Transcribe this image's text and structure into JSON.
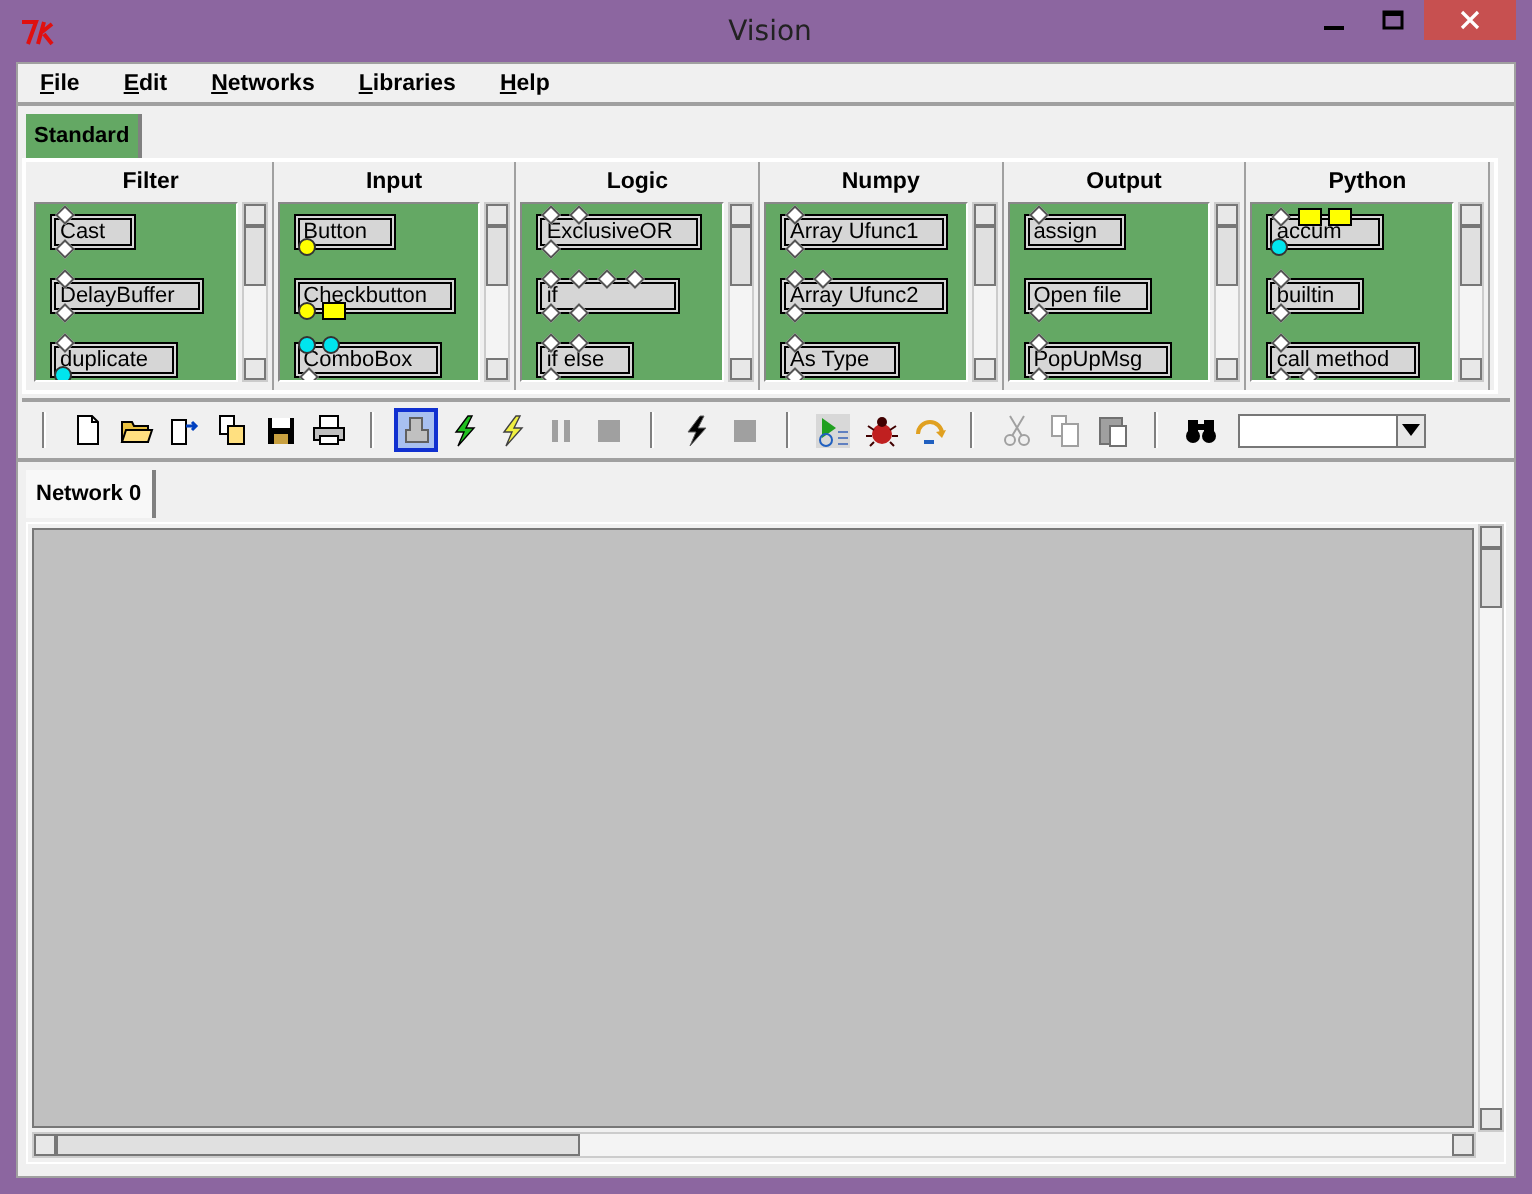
{
  "window": {
    "title": "Vision"
  },
  "menu": [
    {
      "label": "File"
    },
    {
      "label": "Edit"
    },
    {
      "label": "Networks"
    },
    {
      "label": "Libraries"
    },
    {
      "label": "Help"
    }
  ],
  "library_tabs": [
    {
      "label": "Standard",
      "selected": true
    }
  ],
  "categories": [
    {
      "name": "Filter",
      "nodes": [
        {
          "label": "Cast",
          "top": [
            {
              "kind": "diamond"
            }
          ],
          "bottom": [
            {
              "kind": "diamond"
            }
          ]
        },
        {
          "label": "DelayBuffer",
          "top": [
            {
              "kind": "diamond"
            }
          ],
          "bottom": [
            {
              "kind": "diamond"
            }
          ]
        },
        {
          "label": "duplicate",
          "top": [
            {
              "kind": "diamond"
            }
          ],
          "bottom": [
            {
              "kind": "dot",
              "color": "#00e5ee"
            }
          ]
        }
      ]
    },
    {
      "name": "Input",
      "nodes": [
        {
          "label": "Button",
          "bottom": [
            {
              "kind": "dot",
              "color": "#ffff00"
            }
          ]
        },
        {
          "label": "Checkbutton",
          "bottom": [
            {
              "kind": "dot",
              "color": "#ffff00"
            },
            {
              "kind": "square",
              "color": "#ffff00"
            }
          ]
        },
        {
          "label": "ComboBox",
          "top": [
            {
              "kind": "dot",
              "color": "#00e5ee"
            },
            {
              "kind": "dot",
              "color": "#00e5ee"
            }
          ],
          "bottom": [
            {
              "kind": "diamond"
            }
          ]
        }
      ]
    },
    {
      "name": "Logic",
      "nodes": [
        {
          "label": "ExclusiveOR",
          "top": [
            {
              "kind": "diamond"
            },
            {
              "kind": "diamond"
            }
          ],
          "bottom": [
            {
              "kind": "diamond"
            }
          ]
        },
        {
          "label": "if",
          "top": [
            {
              "kind": "diamond"
            },
            {
              "kind": "diamond"
            },
            {
              "kind": "diamond"
            },
            {
              "kind": "diamond"
            }
          ],
          "bottom": [
            {
              "kind": "diamond"
            },
            {
              "kind": "diamond"
            }
          ]
        },
        {
          "label": "if else",
          "top": [
            {
              "kind": "diamond"
            },
            {
              "kind": "diamond"
            }
          ],
          "bottom": [
            {
              "kind": "diamond"
            }
          ]
        }
      ]
    },
    {
      "name": "Numpy",
      "nodes": [
        {
          "label": "Array Ufunc1",
          "top": [
            {
              "kind": "diamond"
            }
          ],
          "bottom": [
            {
              "kind": "diamond"
            }
          ]
        },
        {
          "label": "Array Ufunc2",
          "top": [
            {
              "kind": "diamond"
            },
            {
              "kind": "diamond"
            }
          ],
          "bottom": [
            {
              "kind": "diamond"
            }
          ]
        },
        {
          "label": "As Type",
          "top": [
            {
              "kind": "diamond"
            }
          ],
          "bottom": [
            {
              "kind": "diamond"
            }
          ]
        }
      ]
    },
    {
      "name": "Output",
      "nodes": [
        {
          "label": "assign",
          "top": [
            {
              "kind": "diamond"
            }
          ]
        },
        {
          "label": "Open file",
          "bottom": [
            {
              "kind": "diamond"
            }
          ]
        },
        {
          "label": "PopUpMsg",
          "top": [
            {
              "kind": "diamond"
            }
          ],
          "bottom": [
            {
              "kind": "diamond"
            }
          ]
        }
      ]
    },
    {
      "name": "Python",
      "nodes": [
        {
          "label": "accum",
          "top": [
            {
              "kind": "diamond"
            },
            {
              "kind": "square",
              "color": "#ffff00"
            },
            {
              "kind": "square",
              "color": "#ffff00"
            }
          ],
          "bottom": [
            {
              "kind": "dot",
              "color": "#00e5ee"
            }
          ]
        },
        {
          "label": "builtin",
          "top": [
            {
              "kind": "diamond"
            }
          ],
          "bottom": [
            {
              "kind": "diamond"
            }
          ]
        },
        {
          "label": "call method",
          "top": [
            {
              "kind": "diamond"
            }
          ],
          "bottom": [
            {
              "kind": "diamond"
            },
            {
              "kind": "diamond"
            }
          ]
        }
      ]
    }
  ],
  "toolbar": [
    [
      {
        "disabled": false,
        "selected": false
      },
      {
        "disabled": false,
        "selected": false
      },
      {
        "disabled": false,
        "selected": false
      },
      {
        "disabled": false,
        "selected": false
      },
      {
        "disabled": false,
        "selected": false
      },
      {
        "disabled": false,
        "selected": false
      }
    ],
    [
      {
        "disabled": false,
        "selected": true
      },
      {
        "disabled": false,
        "selected": false
      },
      {
        "disabled": false,
        "selected": false
      },
      {
        "disabled": true,
        "selected": false
      },
      {
        "disabled": true,
        "selected": false
      }
    ],
    [
      {
        "disabled": false,
        "selected": false
      },
      {
        "disabled": true,
        "selected": false
      }
    ],
    [
      {
        "disabled": false,
        "selected": false
      },
      {
        "disabled": false,
        "selected": false
      },
      {
        "disabled": false,
        "selected": false
      }
    ],
    [
      {
        "disabled": true,
        "selected": false
      },
      {
        "disabled": true,
        "selected": false
      },
      {
        "disabled": true,
        "selected": false
      }
    ],
    [
      {
        "disabled": false,
        "selected": false
      }
    ]
  ],
  "network_tabs": [
    {
      "label": "Network 0",
      "selected": true
    }
  ]
}
